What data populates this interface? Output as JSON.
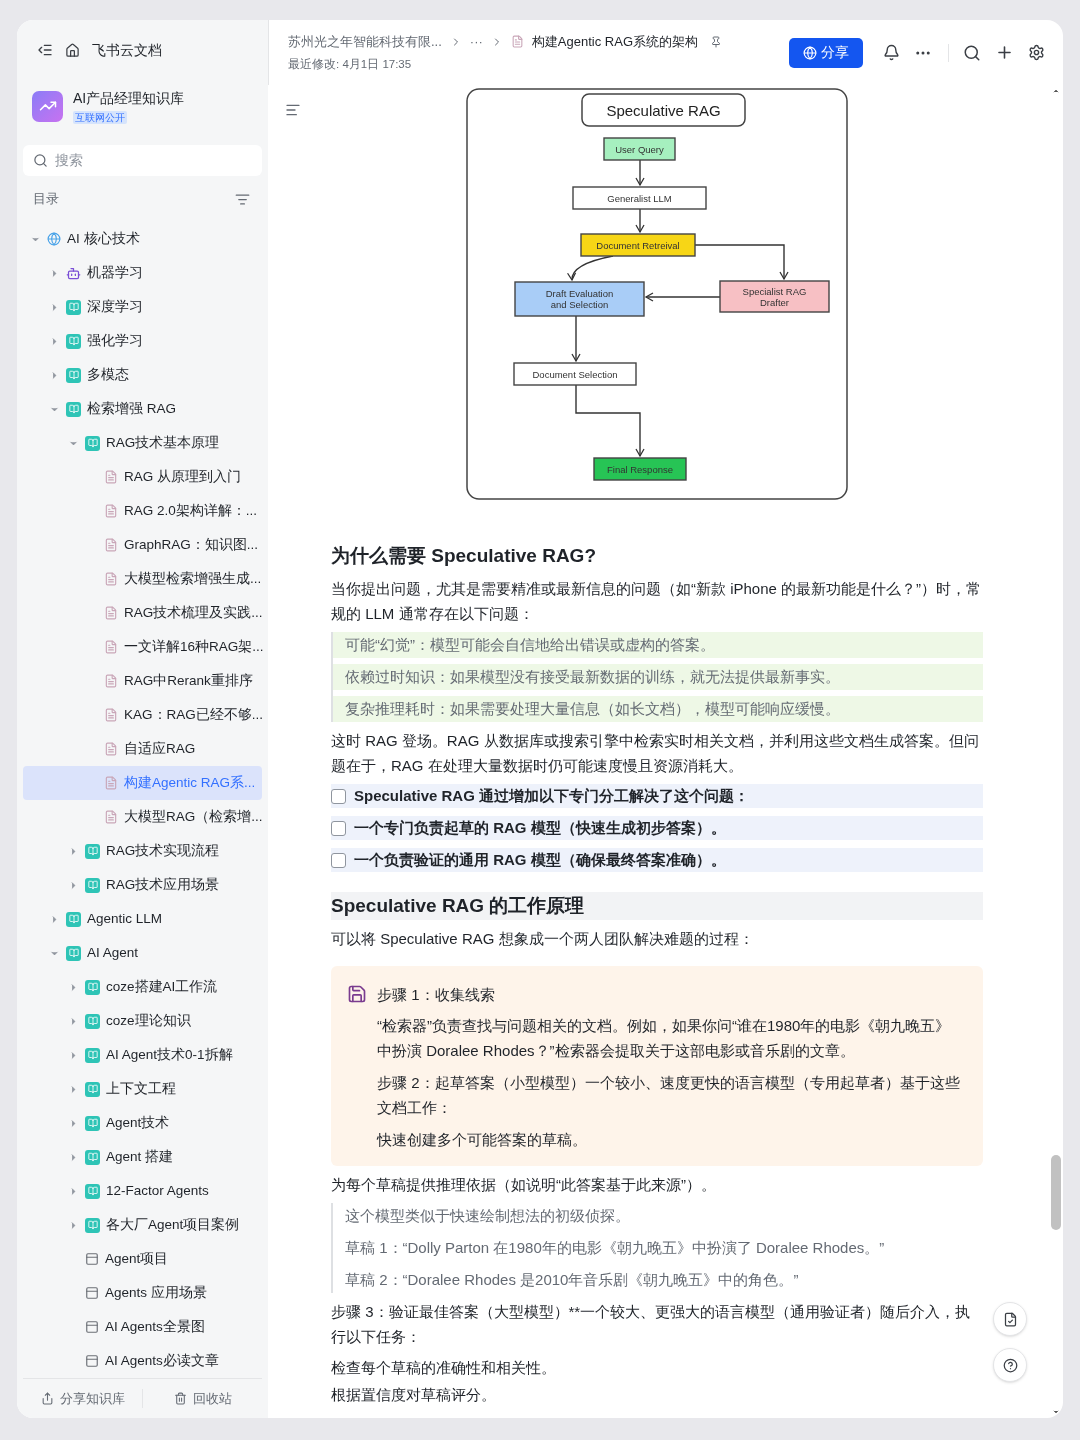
{
  "app": {
    "title": "飞书云文档"
  },
  "knowledge_base": {
    "name": "AI产品经理知识库",
    "badge": "互联网公开"
  },
  "search": {
    "placeholder": "搜索"
  },
  "toc": {
    "label": "目录"
  },
  "tree": [
    {
      "label": "AI 核心技术",
      "kind": "globe",
      "expanded": true,
      "selected": false,
      "children": [
        {
          "label": "机器学习",
          "kind": "robot",
          "expanded": false,
          "selected": false
        },
        {
          "label": "深度学习",
          "kind": "folder",
          "expanded": false,
          "selected": false
        },
        {
          "label": "强化学习",
          "kind": "folder",
          "expanded": false,
          "selected": false
        },
        {
          "label": "多模态",
          "kind": "folder",
          "expanded": false,
          "selected": false
        },
        {
          "label": "检索增强 RAG",
          "kind": "folder",
          "expanded": true,
          "selected": false,
          "children": [
            {
              "label": "RAG技术基本原理",
              "kind": "folder",
              "expanded": true,
              "selected": false,
              "children": [
                {
                  "label": "RAG 从原理到入门",
                  "kind": "doc",
                  "selected": false
                },
                {
                  "label": "RAG 2.0架构详解：...",
                  "kind": "doc",
                  "selected": false
                },
                {
                  "label": "GraphRAG：知识图...",
                  "kind": "doc",
                  "selected": false
                },
                {
                  "label": "大模型检索增强生成...",
                  "kind": "doc",
                  "selected": false
                },
                {
                  "label": "RAG技术梳理及实践...",
                  "kind": "doc",
                  "selected": false
                },
                {
                  "label": "一文详解16种RAG架...",
                  "kind": "doc",
                  "selected": false
                },
                {
                  "label": "RAG中Rerank重排序",
                  "kind": "doc",
                  "selected": false
                },
                {
                  "label": "KAG：RAG已经不够...",
                  "kind": "doc",
                  "selected": false
                },
                {
                  "label": "自适应RAG",
                  "kind": "doc",
                  "selected": false
                },
                {
                  "label": "构建Agentic RAG系...",
                  "kind": "doc",
                  "selected": true
                },
                {
                  "label": "大模型RAG（检索增...",
                  "kind": "doc",
                  "selected": false
                }
              ]
            },
            {
              "label": "RAG技术实现流程",
              "kind": "folder",
              "expanded": false,
              "selected": false
            },
            {
              "label": "RAG技术应用场景",
              "kind": "folder",
              "expanded": false,
              "selected": false
            }
          ]
        },
        {
          "label": "Agentic LLM",
          "kind": "folder",
          "expanded": false,
          "selected": false
        },
        {
          "label": "AI Agent",
          "kind": "folder",
          "expanded": true,
          "selected": false,
          "children": [
            {
              "label": "coze搭建AI工作流",
              "kind": "folder",
              "expanded": false,
              "selected": false
            },
            {
              "label": "coze理论知识",
              "kind": "folder",
              "expanded": false,
              "selected": false
            },
            {
              "label": "AI Agent技术0-1拆解",
              "kind": "folder",
              "expanded": false,
              "selected": false
            },
            {
              "label": "上下文工程",
              "kind": "folder",
              "expanded": false,
              "selected": false
            },
            {
              "label": "Agent技术",
              "kind": "folder",
              "expanded": false,
              "selected": false
            },
            {
              "label": "Agent 搭建",
              "kind": "folder",
              "expanded": false,
              "selected": false
            },
            {
              "label": "12-Factor Agents",
              "kind": "folder",
              "expanded": false,
              "selected": false
            },
            {
              "label": "各大厂Agent项目案例",
              "kind": "folder",
              "expanded": false,
              "selected": false
            },
            {
              "label": "Agent项目",
              "kind": "page",
              "selected": false
            },
            {
              "label": "Agents 应用场景",
              "kind": "page",
              "selected": false
            },
            {
              "label": "AI Agents全景图",
              "kind": "page",
              "selected": false
            },
            {
              "label": "AI Agents必读文章",
              "kind": "page",
              "selected": false
            }
          ]
        }
      ]
    }
  ],
  "sidebar_footer": [
    "分享知识库",
    "回收站"
  ],
  "breadcrumb": {
    "org": "苏州光之年智能科技有限...",
    "ellipsis": "···",
    "doc": "构建Agentic RAG系统的架构",
    "modified": "最近修改: 4月1日 17:35"
  },
  "share_button": "分享",
  "diagram": {
    "title": "Speculative RAG",
    "nodes": [
      {
        "lines": [
          "User Query"
        ],
        "color": "#a6f0bf"
      },
      {
        "lines": [
          "Generalist LLM"
        ],
        "color": "#ffffff"
      },
      {
        "lines": [
          "Document Retreival"
        ],
        "color": "#f7d616"
      },
      {
        "lines": [
          "Draft Evaluation",
          "and Selection"
        ],
        "color": "#a9cdf7"
      },
      {
        "lines": [
          "Specialist RAG",
          "Drafter"
        ],
        "color": "#f7c0c4"
      },
      {
        "lines": [
          "Document Selection"
        ],
        "color": "#ffffff"
      },
      {
        "lines": [
          "Final Response"
        ],
        "color": "#27c455"
      }
    ]
  },
  "blocks": [
    {
      "kind": "heading1",
      "text": "为什么需要 Speculative RAG?"
    },
    {
      "kind": "paragraph",
      "text": "当你提出问题，尤其是需要精准或最新信息的问题（如“新款 iPhone 的最新功能是什么？”）时，常规的 LLM 通常存在以下问题："
    },
    {
      "kind": "quote",
      "highlight": true,
      "lines": [
        "可能“幻觉”：模型可能会自信地给出错误或虚构的答案。",
        "依赖过时知识：如果模型没有接受最新数据的训练，就无法提供最新事实。",
        "复杂推理耗时：如果需要处理大量信息（如长文档），模型可能响应缓慢。"
      ]
    },
    {
      "kind": "paragraph",
      "text": "这时 RAG 登场。RAG 从数据库或搜索引擎中检索实时相关文档，并利用这些文档生成答案。但问题在于，RAG 在处理大量数据时仍可能速度慢且资源消耗大。"
    },
    {
      "kind": "todo",
      "items": [
        {
          "text": "Speculative RAG 通过增加以下专门分工解决了这个问题：",
          "checked": false
        },
        {
          "text": "一个专门负责起草的 RAG 模型（快速生成初步答案）。",
          "checked": false
        },
        {
          "text": "一个负责验证的通用 RAG 模型（确保最终答案准确）。",
          "checked": false
        }
      ]
    },
    {
      "kind": "heading2",
      "text": "Speculative RAG 的工作原理"
    },
    {
      "kind": "paragraph",
      "text": "可以将 Speculative RAG 想象成一个两人团队解决难题的过程："
    },
    {
      "kind": "callout",
      "title": "步骤 1：收集线索",
      "paragraphs": [
        "“检索器”负责查找与问题相关的文档。例如，如果你问“谁在1980年的电影《朝九晚五》中扮演 Doralee Rhodes？”检索器会提取关于这部电影或音乐剧的文章。",
        "步骤 2：起草答案（小型模型）一个较小、速度更快的语言模型（专用起草者）基于这些文档工作：",
        "快速创建多个可能答案的草稿。"
      ]
    },
    {
      "kind": "paragraph",
      "text": "为每个草稿提供推理依据（如说明“此答案基于此来源”）。"
    },
    {
      "kind": "quote",
      "highlight": false,
      "lines": [
        "这个模型类似于快速绘制想法的初级侦探。",
        "草稿 1：“Dolly Parton 在1980年的电影《朝九晚五》中扮演了 Doralee Rhodes。”",
        "草稿 2：“Doralee Rhodes 是2010年音乐剧《朝九晚五》中的角色。”"
      ]
    },
    {
      "kind": "paragraph",
      "text": "步骤 3：验证最佳答案（大型模型）**一个较大、更强大的语言模型（通用验证者）随后介入，执行以下任务："
    },
    {
      "kind": "paragraph",
      "text": "检查每个草稿的准确性和相关性。"
    },
    {
      "kind": "paragraph",
      "text": "根据置信度对草稿评分。"
    }
  ]
}
